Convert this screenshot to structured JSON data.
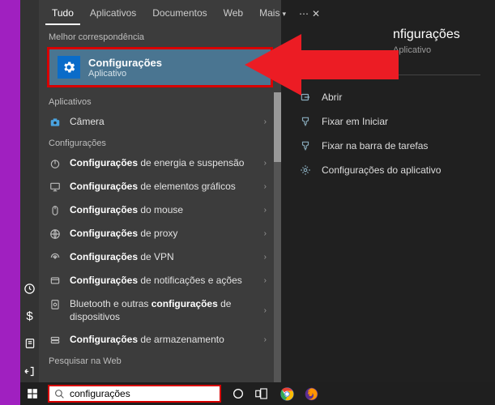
{
  "tabs": {
    "all": "Tudo",
    "apps": "Aplicativos",
    "docs": "Documentos",
    "web": "Web",
    "more": "Mais"
  },
  "sections": {
    "best": "Melhor correspondência",
    "apps": "Aplicativos",
    "cfg": "Configurações",
    "web": "Pesquisar na Web"
  },
  "best_match": {
    "title": "Configurações",
    "subtitle": "Aplicativo"
  },
  "apps_results": [
    {
      "icon": "camera-icon",
      "html": "Câmera"
    }
  ],
  "cfg_results": [
    {
      "icon": "power-icon",
      "html": "<b>Configurações</b> de energia e suspensão"
    },
    {
      "icon": "display-icon",
      "html": "<b>Configurações</b> de elementos gráficos"
    },
    {
      "icon": "mouse-icon",
      "html": "<b>Configurações</b> do mouse"
    },
    {
      "icon": "globe-icon",
      "html": "<b>Configurações</b> de proxy"
    },
    {
      "icon": "vpn-icon",
      "html": "<b>Configurações</b> de VPN"
    },
    {
      "icon": "notify-icon",
      "html": "<b>Configurações</b> de notificações e ações"
    },
    {
      "icon": "bluetooth-icon",
      "html": "Bluetooth e outras <b>configurações</b> de dispositivos"
    },
    {
      "icon": "storage-icon",
      "html": "<b>Configurações</b> de armazenamento"
    }
  ],
  "detail": {
    "title": "nfigurações",
    "subtitle": "Aplicativo"
  },
  "actions": [
    {
      "icon": "open-icon",
      "label": "Abrir"
    },
    {
      "icon": "pin-start-icon",
      "label": "Fixar em Iniciar"
    },
    {
      "icon": "pin-task-icon",
      "label": "Fixar na barra de tarefas"
    },
    {
      "icon": "gear-icon",
      "label": "Configurações do aplicativo"
    }
  ],
  "search": {
    "value": "configurações"
  },
  "colors": {
    "highlight_border": "#d80000",
    "selected_bg": "#4a7591",
    "accent": "#0a6cc9"
  }
}
